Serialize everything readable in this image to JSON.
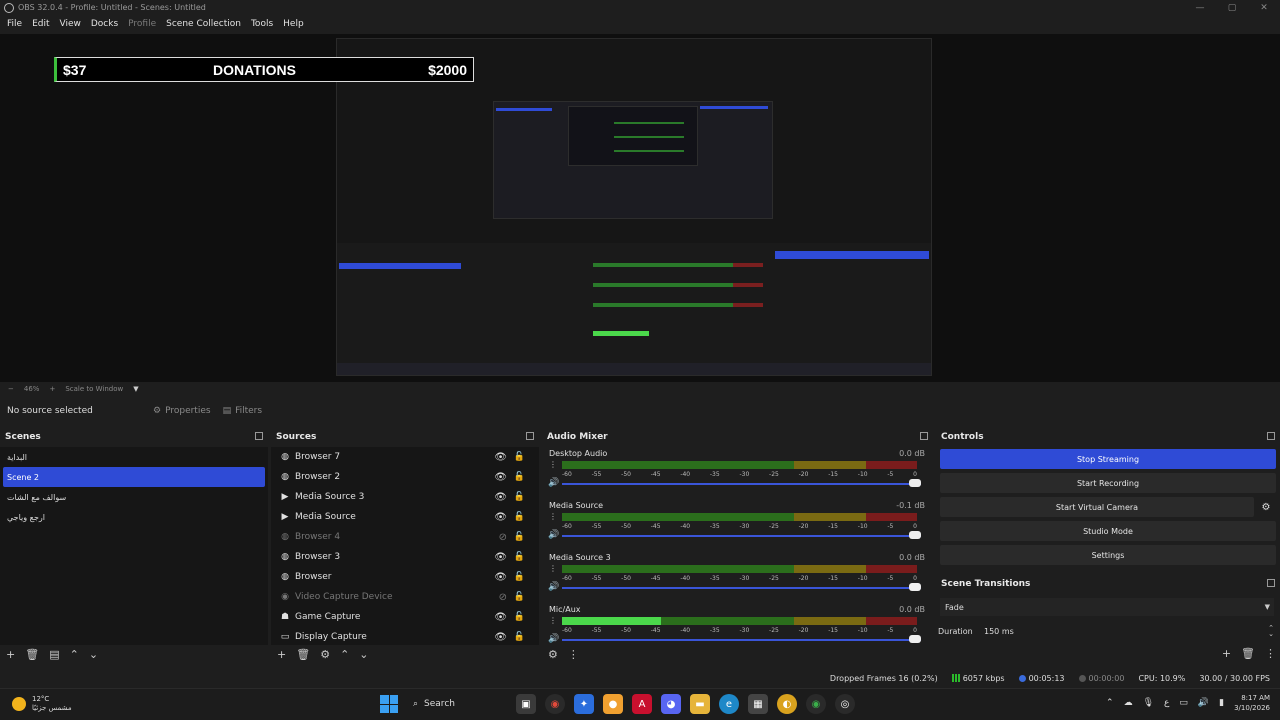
{
  "window": {
    "title": "OBS 32.0.4 - Profile: Untitled - Scenes: Untitled"
  },
  "menu": [
    {
      "label": "File",
      "disabled": false
    },
    {
      "label": "Edit",
      "disabled": false
    },
    {
      "label": "View",
      "disabled": false
    },
    {
      "label": "Docks",
      "disabled": false
    },
    {
      "label": "Profile",
      "disabled": true
    },
    {
      "label": "Scene Collection",
      "disabled": false
    },
    {
      "label": "Tools",
      "disabled": false
    },
    {
      "label": "Help",
      "disabled": false
    }
  ],
  "preview": {
    "donation": {
      "current": "$37",
      "title": "DONATIONS",
      "goal": "$2000"
    },
    "zoom": {
      "percent": "46%",
      "mode": "Scale to Window"
    }
  },
  "source_toolbar": {
    "no_source": "No source selected",
    "properties": "Properties",
    "filters": "Filters"
  },
  "scenes": {
    "title": "Scenes",
    "items": [
      {
        "label": "البداية",
        "active": false
      },
      {
        "label": "Scene 2",
        "active": true
      },
      {
        "label": "سوالف مع الشات",
        "active": false
      },
      {
        "label": "ارجع وياجي",
        "active": false
      }
    ]
  },
  "sources": {
    "title": "Sources",
    "items": [
      {
        "label": "Browser 7",
        "icon": "globe-icon",
        "glyph": "◍",
        "visible": true
      },
      {
        "label": "Browser 2",
        "icon": "globe-icon",
        "glyph": "◍",
        "visible": true
      },
      {
        "label": "Media Source 3",
        "icon": "play-icon",
        "glyph": "▶",
        "visible": true
      },
      {
        "label": "Media Source",
        "icon": "play-icon",
        "glyph": "▶",
        "visible": true
      },
      {
        "label": "Browser 4",
        "icon": "globe-icon",
        "glyph": "◍",
        "visible": false
      },
      {
        "label": "Browser 3",
        "icon": "globe-icon",
        "glyph": "◍",
        "visible": true
      },
      {
        "label": "Browser",
        "icon": "globe-icon",
        "glyph": "◍",
        "visible": true
      },
      {
        "label": "Video Capture Device",
        "icon": "camera-icon",
        "glyph": "◉",
        "visible": false
      },
      {
        "label": "Game Capture",
        "icon": "gamepad-icon",
        "glyph": "☗",
        "visible": true
      },
      {
        "label": "Display Capture",
        "icon": "monitor-icon",
        "glyph": "▭",
        "visible": true
      }
    ]
  },
  "mixer": {
    "title": "Audio Mixer",
    "ticks": [
      "-60",
      "-55",
      "-50",
      "-45",
      "-40",
      "-35",
      "-30",
      "-25",
      "-20",
      "-15",
      "-10",
      "-5",
      "0"
    ],
    "channels": [
      {
        "name": "Desktop Audio",
        "db": "0.0 dB",
        "level": 0
      },
      {
        "name": "Media Source",
        "db": "-0.1 dB",
        "level": 0
      },
      {
        "name": "Media Source 3",
        "db": "0.0 dB",
        "level": 0
      },
      {
        "name": "Mic/Aux",
        "db": "0.0 dB",
        "level": 0.28
      }
    ]
  },
  "controls": {
    "title": "Controls",
    "stop_streaming": "Stop Streaming",
    "start_recording": "Start Recording",
    "start_virtual_camera": "Start Virtual Camera",
    "studio_mode": "Studio Mode",
    "settings": "Settings"
  },
  "transitions": {
    "title": "Scene Transitions",
    "selected": "Fade",
    "duration_label": "Duration",
    "duration_value": "150 ms"
  },
  "status": {
    "dropped_frames": "Dropped Frames 16 (0.2%)",
    "bitrate": "6057 kbps",
    "stream_time": "00:05:13",
    "record_time": "00:00:00",
    "cpu": "CPU: 10.9%",
    "fps": "30.00 / 30.00 FPS"
  },
  "taskbar": {
    "temperature": "12°C",
    "weather_desc": "مشمس جزئيًا",
    "search": "Search",
    "time": "8:17 AM",
    "date": "3/10/2026"
  },
  "colors": {
    "accent": "#2f4bd6",
    "meter_green": "#2b6e1c",
    "meter_active": "#4bd84b"
  }
}
